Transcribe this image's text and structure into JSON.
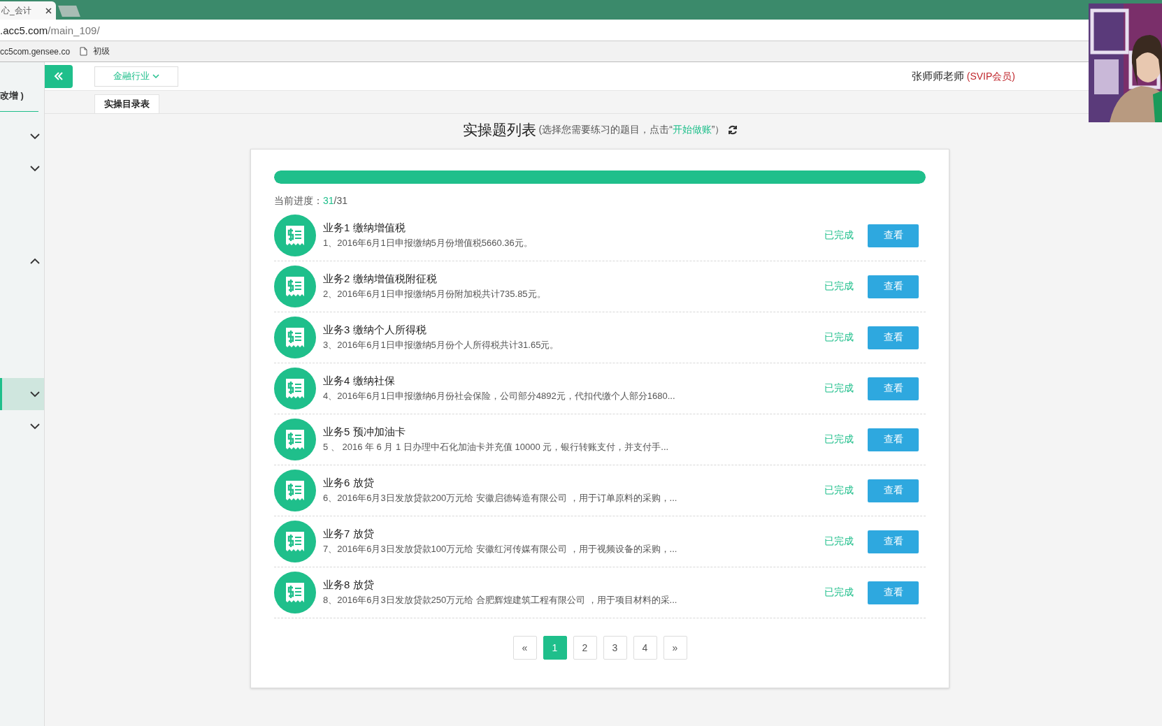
{
  "browser": {
    "tab_title": "心_会计",
    "address_domain": ".acc5.com",
    "address_path": "/main_109/",
    "bookmarks": [
      {
        "label": "cc5com.gensee.co",
        "kind": "site"
      },
      {
        "label": "初级",
        "kind": "page"
      }
    ]
  },
  "sidebar": {
    "current": {
      "label": "改增 )",
      "selected": true
    },
    "groups": [
      {
        "expanded": false,
        "selected": false
      },
      {
        "expanded": false,
        "selected": false
      },
      {
        "expanded": true,
        "selected": false
      },
      {
        "expanded": false,
        "selected": true
      },
      {
        "expanded": false,
        "selected": false
      }
    ]
  },
  "header": {
    "industry": "金融行业",
    "user_name": "张师师老师",
    "member_badge": "(SVIP会员)"
  },
  "tabs": [
    {
      "label": "实操目录表",
      "selected": true
    }
  ],
  "page": {
    "title": "实操题列表",
    "hint_before": "(选择您需要练习的题目，点击“",
    "hint_link": "开始做账",
    "hint_after": "”）"
  },
  "progress": {
    "level": 1,
    "label": "当前进度：",
    "done": "31",
    "total": "/31"
  },
  "tasks": [
    {
      "title": "业务1 缴纳增值税",
      "desc": "1、2016年6月1日申报缴纳5月份增值税5660.36元。",
      "status": "已完成",
      "done": true,
      "button": "查看"
    },
    {
      "title": "业务2 缴纳增值税附征税",
      "desc": "2、2016年6月1日申报缴纳5月份附加税共计735.85元。",
      "status": "已完成",
      "done": true,
      "button": "查看"
    },
    {
      "title": "业务3 缴纳个人所得税",
      "desc": "3、2016年6月1日申报缴纳5月份个人所得税共计31.65元。",
      "status": "已完成",
      "done": true,
      "button": "查看"
    },
    {
      "title": "业务4 缴纳社保",
      "desc": "4、2016年6月1日申报缴纳6月份社会保险，公司部分4892元，代扣代缴个人部分1680...",
      "status": "已完成",
      "done": true,
      "button": "查看"
    },
    {
      "title": "业务5 预冲加油卡",
      "desc": "5 、 2016 年 6 月 1 日办理中石化加油卡并充值 10000 元，银行转账支付，并支付手...",
      "status": "已完成",
      "done": true,
      "button": "查看"
    },
    {
      "title": "业务6 放贷",
      "desc": "6、2016年6月3日发放贷款200万元给 安徽启德铸造有限公司 ，用于订单原料的采购，...",
      "status": "已完成",
      "done": true,
      "button": "查看"
    },
    {
      "title": "业务7 放贷",
      "desc": "7、2016年6月3日发放贷款100万元给 安徽红河传媒有限公司 ，用于视频设备的采购，...",
      "status": "已完成",
      "done": true,
      "button": "查看"
    },
    {
      "title": "业务8 放贷",
      "desc": "8、2016年6月3日发放贷款250万元给 合肥辉煌建筑工程有限公司 ，用于项目材料的采...",
      "status": "已完成",
      "done": true,
      "button": "查看"
    }
  ],
  "pagination": [
    {
      "label": "«",
      "selected": false
    },
    {
      "label": "1",
      "selected": true
    },
    {
      "label": "2",
      "selected": false
    },
    {
      "label": "3",
      "selected": false
    },
    {
      "label": "4",
      "selected": false
    },
    {
      "label": "»",
      "selected": false
    }
  ]
}
